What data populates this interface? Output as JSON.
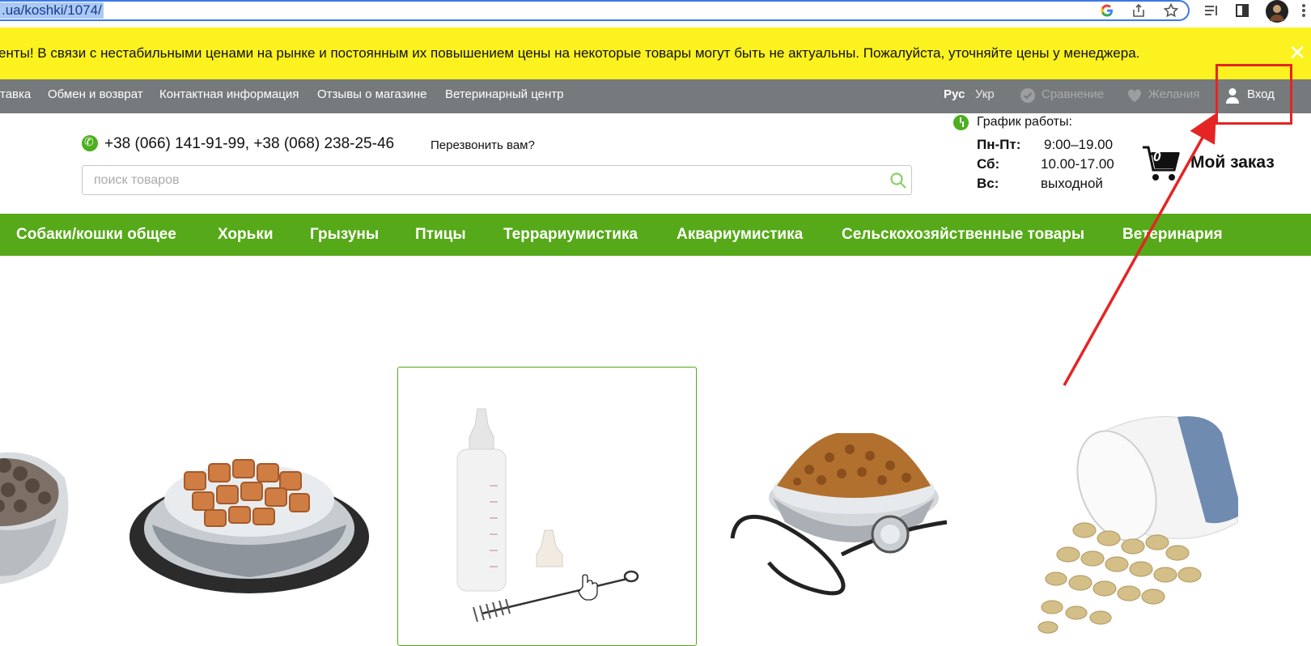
{
  "browser": {
    "url": ".ua/koshki/1074/",
    "icons": [
      "google-icon",
      "share-icon",
      "star-icon",
      "reading-list-icon",
      "sidebar-icon",
      "avatar",
      "more-icon"
    ]
  },
  "notice": {
    "text": "енты! В связи с нестабильными ценами на рынке и постоянным их повышением цены на некоторые товары могут быть не актуальны. Пожалуйста, уточняйте цены у менеджера.",
    "close": "✕"
  },
  "topnav": {
    "links": [
      "тавка",
      "Обмен и возврат",
      "Контактная информация",
      "Отзывы о магазине",
      "Ветеринарный центр"
    ],
    "lang_ru": "Рус",
    "lang_ua": "Укр",
    "compare": "Сравнение",
    "wishlist": "Желания",
    "login": "Вход"
  },
  "header": {
    "phones": "+38 (066) 141-91-99,   +38 (068) 238-25-46",
    "callback": "Перезвонить вам?",
    "search_placeholder": "поиск товаров",
    "schedule_title": "График работы:",
    "schedule": [
      {
        "day": "Пн-Пт:",
        "hours": "9:00–19.00"
      },
      {
        "day": "Сб:",
        "hours": "10.00-17.00"
      },
      {
        "day": "Вс:",
        "hours": "выходной"
      }
    ],
    "cart_count": "0",
    "order_label": "Мой заказ"
  },
  "mainnav": {
    "items": [
      "Собаки/кошки общее",
      "Хорьки",
      "Грызуны",
      "Птицы",
      "Террариумистика",
      "Аквариумистика",
      "Сельскохозяйственные товары",
      "Ветеринария"
    ]
  },
  "colors": {
    "notice_bg": "#fbf21f",
    "topnav_bg": "#777a7c",
    "mainnav_bg": "#56a918",
    "accent_green": "#4caf1f",
    "annotation_red": "#e52424"
  }
}
